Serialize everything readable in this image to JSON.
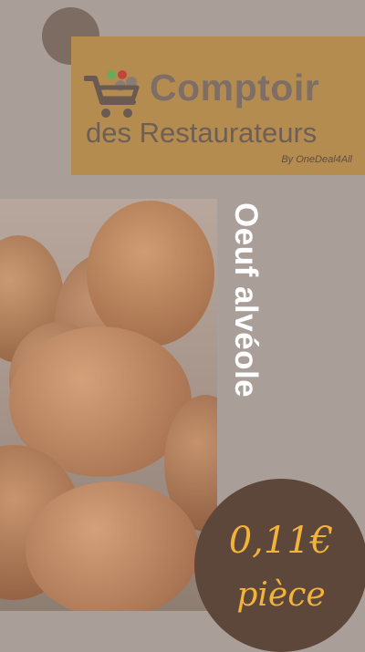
{
  "logo": {
    "brand_main": "Comptoir",
    "brand_sub": "des Restaurateurs",
    "byline": "By OneDeal4All",
    "icon": "shopping-cart-icon"
  },
  "product": {
    "name": "Oeuf alvéole",
    "image": "eggs-photo"
  },
  "price": {
    "amount": "0,11€",
    "unit": "pièce"
  },
  "colors": {
    "background": "#a99f98",
    "logo_panel": "#b48c4f",
    "price_circle": "#5d463a",
    "price_text": "#f2b33b",
    "title_text": "#ffffff"
  }
}
